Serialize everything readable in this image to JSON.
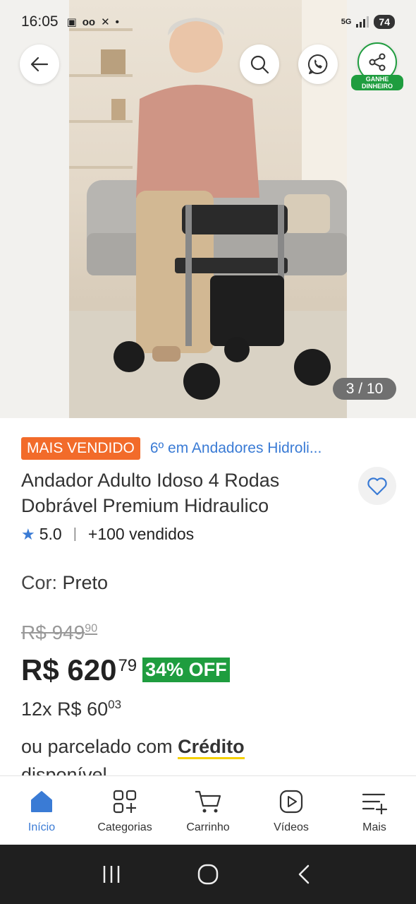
{
  "status_bar": {
    "time": "16:05",
    "network": "5G",
    "battery": "74"
  },
  "hero": {
    "image_counter": "3 / 10",
    "share_label": "GANHE DINHEIRO"
  },
  "product": {
    "badge": "MAIS VENDIDO",
    "ranking": "6º em Andadores Hidroli...",
    "title": "Andador Adulto Idoso 4 Rodas Dobrável Premium Hidraulico",
    "rating": "5.0",
    "sold": "+100 vendidos",
    "color_label": "Cor:",
    "color_value": "Preto",
    "old_price": "R$ 949",
    "old_price_cents": "90",
    "price": "R$ 620",
    "price_cents": "79",
    "discount": "34% OFF",
    "installments_count": "12x",
    "installment_value": "R$ 60",
    "installment_cents": "03",
    "credit_prefix": "ou parcelado com",
    "credit_strong": "Crédito",
    "credit_suffix": "disponível"
  },
  "bottom_nav": [
    {
      "label": "Início",
      "icon": "home-icon",
      "active": true
    },
    {
      "label": "Categorias",
      "icon": "categories-icon",
      "active": false
    },
    {
      "label": "Carrinho",
      "icon": "cart-icon",
      "active": false
    },
    {
      "label": "Vídeos",
      "icon": "video-icon",
      "active": false
    },
    {
      "label": "Mais",
      "icon": "menu-plus-icon",
      "active": false
    }
  ],
  "colors": {
    "accent_blue": "#3a7bd5",
    "badge_orange": "#f26b2a",
    "discount_green": "#1f9d3f",
    "credit_yellow": "#f5d000"
  }
}
